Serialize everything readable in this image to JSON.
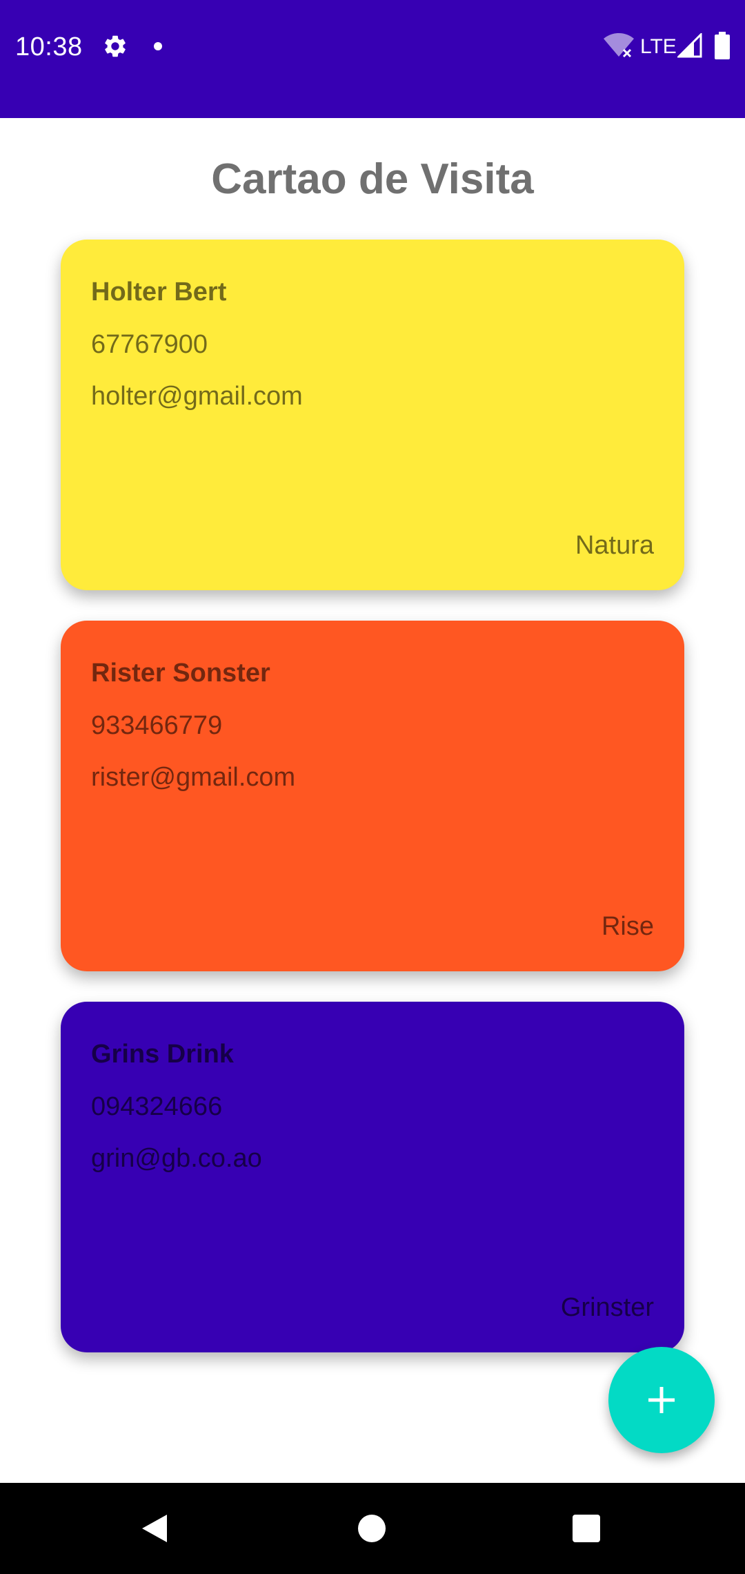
{
  "status_bar": {
    "time": "10:38",
    "network": "LTE",
    "background_color": "#3700B3",
    "icons": [
      "gear-icon",
      "notification-dot-icon",
      "wifi-off-icon",
      "cell-signal-icon",
      "battery-icon"
    ]
  },
  "app": {
    "title": "Cartao de Visita"
  },
  "cards": [
    {
      "name": "Holter Bert",
      "phone": "67767900",
      "email": "holter@gmail.com",
      "company": "Natura",
      "background_color": "#FFEB3B"
    },
    {
      "name": "Rister Sonster",
      "phone": "933466779",
      "email": "rister@gmail.com",
      "company": "Rise",
      "background_color": "#FF5722"
    },
    {
      "name": "Grins Drink",
      "phone": "094324666",
      "email": "grin@gb.co.ao",
      "company": "Grinster",
      "background_color": "#3700B3"
    }
  ],
  "fab": {
    "icon": "plus-icon",
    "color": "#03DAC5"
  },
  "nav_bar": {
    "icons": [
      "back-icon",
      "home-icon",
      "recents-icon"
    ]
  }
}
